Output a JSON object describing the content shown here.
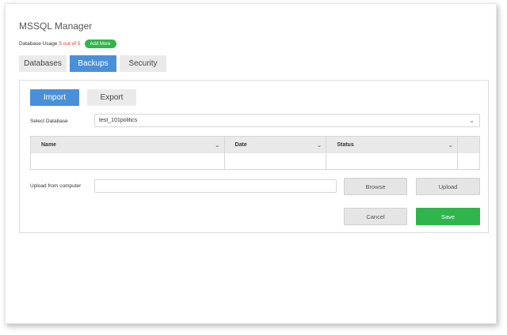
{
  "app": {
    "title": "MSSQL Manager"
  },
  "usage": {
    "label": "Database Usage",
    "count": "5 out of 5",
    "add_more_label": "Add More"
  },
  "tabs": [
    {
      "label": "Databases",
      "active": false
    },
    {
      "label": "Backups",
      "active": true
    },
    {
      "label": "Security",
      "active": false
    }
  ],
  "backups": {
    "import_label": "Import",
    "export_label": "Export",
    "select_db_label": "Select Database",
    "select_db_value": "test_101politics",
    "columns": [
      "Name",
      "Date",
      "Status"
    ],
    "upload_label": "Upload from computer",
    "upload_value": "",
    "browse_label": "Browse",
    "upload_button_label": "Upload",
    "cancel_label": "Cancel",
    "save_label": "Save"
  },
  "colors": {
    "primary": "#4a90d9",
    "success": "#2fb54b",
    "warning_text": "#e0392b"
  },
  "icons": {
    "dropdown": "chevron-down-icon"
  }
}
